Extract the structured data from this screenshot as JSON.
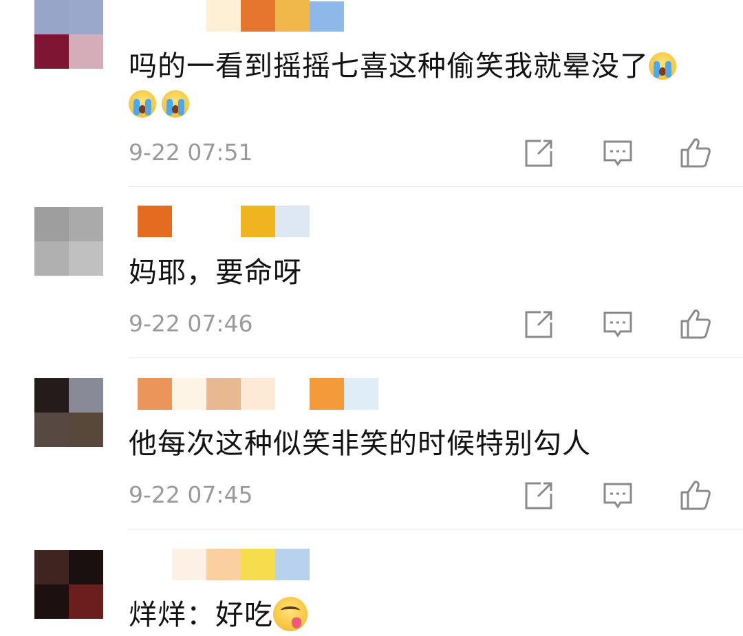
{
  "comments": [
    {
      "text": "吗的一看到摇摇七喜这种偷笑我就晕没了",
      "emoji_inline": "crying-emoji",
      "emoji_line2": [
        "crying-emoji",
        "crying-emoji"
      ],
      "timestamp": "9-22 07:51",
      "avatar_colors": [
        "#97a6c8",
        "#9aa8cb",
        "#7e1532",
        "#d4adb8"
      ],
      "name_blur_colors": [
        "#ffffff",
        "#fdf0d5",
        "#e6762e",
        "#f0b84a",
        "#8fb8ea"
      ]
    },
    {
      "text": "妈耶，要命呀",
      "timestamp": "9-22 07:46",
      "avatar_colors": [
        "#9e9e9e",
        "#aaaaaa",
        "#b0b0b0",
        "#c0c0c0"
      ],
      "name_blur_colors": [
        "#e36c1f",
        "#ffffff",
        "#ffffff",
        "#efb420",
        "#dde8f4"
      ]
    },
    {
      "text": "他每次这种似笑非笑的时候特别勾人",
      "timestamp": "9-22 07:45",
      "avatar_colors": [
        "#231c1b",
        "#888b97",
        "#584842",
        "#58483b"
      ],
      "name_blur_colors": [
        "#ec955b",
        "#fdf4e6",
        "#e8b891",
        "#fde9d6",
        "#ffffff",
        "#f39b3a",
        "#deedf8"
      ]
    },
    {
      "text": "烊烊：好吃",
      "emoji_inline": "yum-emoji",
      "avatar_colors": [
        "#3f2520",
        "#1a1010",
        "#1c1010",
        "#6b1e1c"
      ],
      "name_blur_colors": [
        "#fdf0e4",
        "#fccf9e",
        "#f6dd4e",
        "#b7d1ee"
      ]
    }
  ],
  "actions": {
    "share_icon": "share-edit-icon",
    "comment_icon": "comment-bubble-icon",
    "like_icon": "thumbs-up-icon"
  },
  "colors": {
    "timestamp": "#9a9a9a",
    "icon": "#8a8a8a",
    "divider": "#e4e4e4"
  }
}
